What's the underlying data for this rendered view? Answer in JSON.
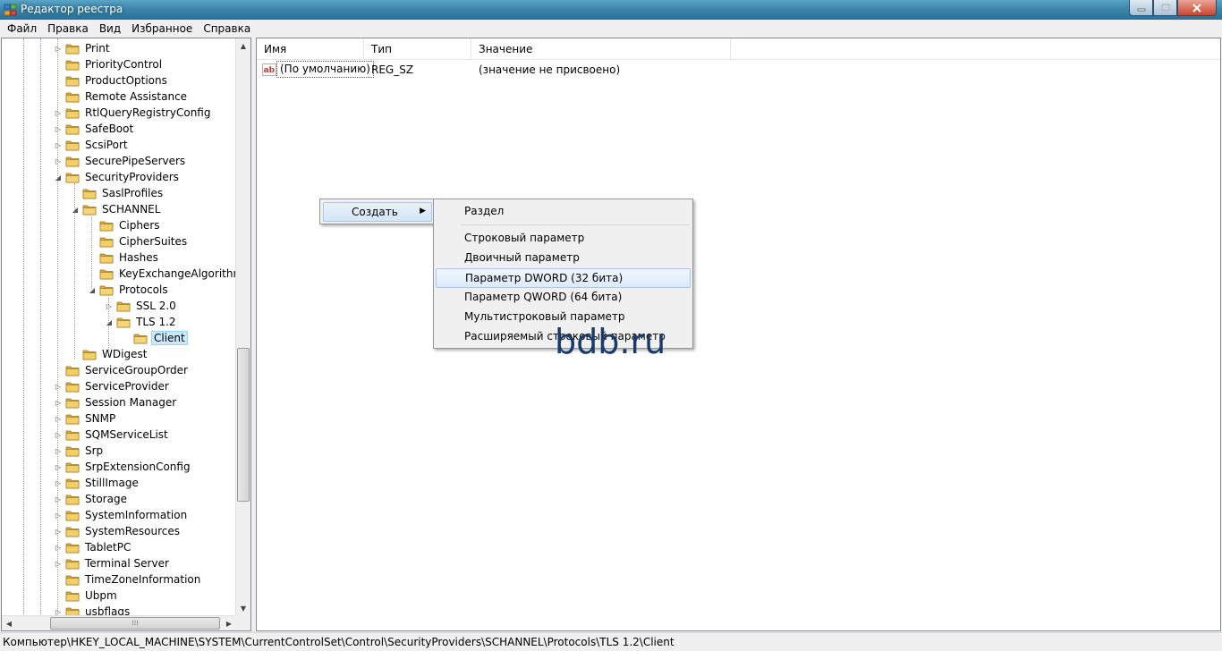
{
  "window": {
    "title": "Редактор реестра",
    "icon": "regedit-icon"
  },
  "menu": [
    "Файл",
    "Правка",
    "Вид",
    "Избранное",
    "Справка"
  ],
  "tree": {
    "items": [
      {
        "label": "Print",
        "level": 0,
        "expander": "collapsed"
      },
      {
        "label": "PriorityControl",
        "level": 0,
        "expander": "none"
      },
      {
        "label": "ProductOptions",
        "level": 0,
        "expander": "none"
      },
      {
        "label": "Remote Assistance",
        "level": 0,
        "expander": "none"
      },
      {
        "label": "RtlQueryRegistryConfig",
        "level": 0,
        "expander": "collapsed"
      },
      {
        "label": "SafeBoot",
        "level": 0,
        "expander": "collapsed"
      },
      {
        "label": "ScsiPort",
        "level": 0,
        "expander": "collapsed"
      },
      {
        "label": "SecurePipeServers",
        "level": 0,
        "expander": "collapsed"
      },
      {
        "label": "SecurityProviders",
        "level": 0,
        "expander": "expanded"
      },
      {
        "label": "SaslProfiles",
        "level": 1,
        "expander": "none"
      },
      {
        "label": "SCHANNEL",
        "level": 1,
        "expander": "expanded"
      },
      {
        "label": "Ciphers",
        "level": 2,
        "expander": "none"
      },
      {
        "label": "CipherSuites",
        "level": 2,
        "expander": "none"
      },
      {
        "label": "Hashes",
        "level": 2,
        "expander": "none"
      },
      {
        "label": "KeyExchangeAlgorithms",
        "level": 2,
        "expander": "none"
      },
      {
        "label": "Protocols",
        "level": 2,
        "expander": "expanded"
      },
      {
        "label": "SSL 2.0",
        "level": 3,
        "expander": "collapsed"
      },
      {
        "label": "TLS 1.2",
        "level": 3,
        "expander": "expanded"
      },
      {
        "label": "Client",
        "level": 4,
        "expander": "none",
        "selected": true
      },
      {
        "label": "WDigest",
        "level": 1,
        "expander": "none"
      },
      {
        "label": "ServiceGroupOrder",
        "level": 0,
        "expander": "none"
      },
      {
        "label": "ServiceProvider",
        "level": 0,
        "expander": "collapsed"
      },
      {
        "label": "Session Manager",
        "level": 0,
        "expander": "collapsed"
      },
      {
        "label": "SNMP",
        "level": 0,
        "expander": "collapsed"
      },
      {
        "label": "SQMServiceList",
        "level": 0,
        "expander": "collapsed"
      },
      {
        "label": "Srp",
        "level": 0,
        "expander": "collapsed"
      },
      {
        "label": "SrpExtensionConfig",
        "level": 0,
        "expander": "collapsed"
      },
      {
        "label": "StillImage",
        "level": 0,
        "expander": "collapsed"
      },
      {
        "label": "Storage",
        "level": 0,
        "expander": "collapsed"
      },
      {
        "label": "SystemInformation",
        "level": 0,
        "expander": "collapsed"
      },
      {
        "label": "SystemResources",
        "level": 0,
        "expander": "collapsed"
      },
      {
        "label": "TabletPC",
        "level": 0,
        "expander": "collapsed"
      },
      {
        "label": "Terminal Server",
        "level": 0,
        "expander": "collapsed"
      },
      {
        "label": "TimeZoneInformation",
        "level": 0,
        "expander": "none"
      },
      {
        "label": "Ubpm",
        "level": 0,
        "expander": "none"
      },
      {
        "label": "usbflags",
        "level": 0,
        "expander": "collapsed"
      }
    ]
  },
  "list": {
    "columns": [
      "Имя",
      "Тип",
      "Значение"
    ],
    "rows": [
      {
        "name": "(По умолчанию)",
        "type": "REG_SZ",
        "value": "(значение не присвоено)",
        "icon": "string-value-icon"
      }
    ]
  },
  "context_menu": {
    "item": "Создать"
  },
  "submenu": {
    "items": [
      "Раздел",
      "Строковый параметр",
      "Двоичный параметр",
      "Параметр DWORD (32 бита)",
      "Параметр QWORD (64 бита)",
      "Мультистроковый параметр",
      "Расширяемый строковый параметр"
    ],
    "highlighted": "Параметр DWORD (32 бита)"
  },
  "watermark": "bdb.ru",
  "status": {
    "path": "Компьютер\\HKEY_LOCAL_MACHINE\\SYSTEM\\CurrentControlSet\\Control\\SecurityProviders\\SCHANNEL\\Protocols\\TLS 1.2\\Client"
  },
  "colors": {
    "folder": "#e8c25a",
    "selection": "#cce8ff",
    "watermark": "#1a3a6b"
  }
}
